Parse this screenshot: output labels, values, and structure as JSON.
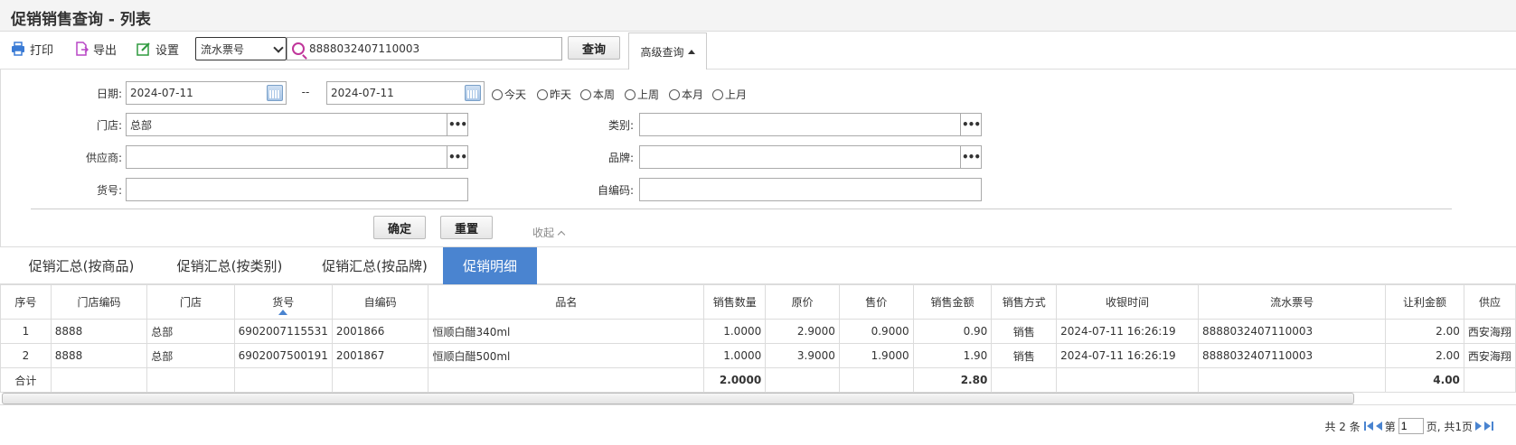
{
  "window": {
    "title": "促销销售查询 - 列表"
  },
  "toolbar": {
    "print_label": "打印",
    "export_label": "导出",
    "settings_label": "设置",
    "search_field_selected": "流水票号",
    "search_value": "8888032407110003",
    "query_label": "查询",
    "advanced_label": "高级查询",
    "icon_colors": {
      "print": "#3a7bd5",
      "export": "#b847c6",
      "settings": "#2e9a3e"
    }
  },
  "filter": {
    "date_label": "日期:",
    "date_from": "2024-07-11",
    "date_sep": "--",
    "date_to": "2024-07-11",
    "quick_ranges": [
      "今天",
      "昨天",
      "本周",
      "上周",
      "本月",
      "上月"
    ],
    "store_label": "门店:",
    "store_value": "总部",
    "category_label": "类别:",
    "category_value": "",
    "supplier_label": "供应商:",
    "supplier_value": "",
    "brand_label": "品牌:",
    "brand_value": "",
    "item_no_label": "货号:",
    "item_no_value": "",
    "self_code_label": "自编码:",
    "self_code_value": "",
    "more_glyph": "•••",
    "confirm_label": "确定",
    "reset_label": "重置",
    "collapse_label": "收起"
  },
  "tabs": [
    {
      "label": "促销汇总(按商品)",
      "active": false
    },
    {
      "label": "促销汇总(按类别)",
      "active": false
    },
    {
      "label": "促销汇总(按品牌)",
      "active": false
    },
    {
      "label": "促销明细",
      "active": true
    }
  ],
  "accent_color": "#4a84d0",
  "table": {
    "columns": [
      "序号",
      "门店编码",
      "门店",
      "货号",
      "自编码",
      "品名",
      "销售数量",
      "原价",
      "售价",
      "销售金额",
      "销售方式",
      "收银时间",
      "流水票号",
      "让利金额",
      "供应"
    ],
    "sorted_column": "货号",
    "rows": [
      [
        "1",
        "8888",
        "总部",
        "6902007115531",
        "2001866",
        "恒顺白醋340ml",
        "1.0000",
        "2.9000",
        "0.9000",
        "0.90",
        "销售",
        "2024-07-11 16:26:19",
        "8888032407110003",
        "2.00",
        "西安海翔"
      ],
      [
        "2",
        "8888",
        "总部",
        "6902007500191",
        "2001867",
        "恒顺白醋500ml",
        "1.0000",
        "3.9000",
        "1.9000",
        "1.90",
        "销售",
        "2024-07-11 16:26:19",
        "8888032407110003",
        "2.00",
        "西安海翔"
      ]
    ],
    "totals": {
      "label": "合计",
      "qty": "2.0000",
      "amount": "2.80",
      "discount": "4.00"
    }
  },
  "pager": {
    "total_text": "共 2 条",
    "page_prefix": "第",
    "page_value": "1",
    "page_suffix": "页, 共1页"
  }
}
